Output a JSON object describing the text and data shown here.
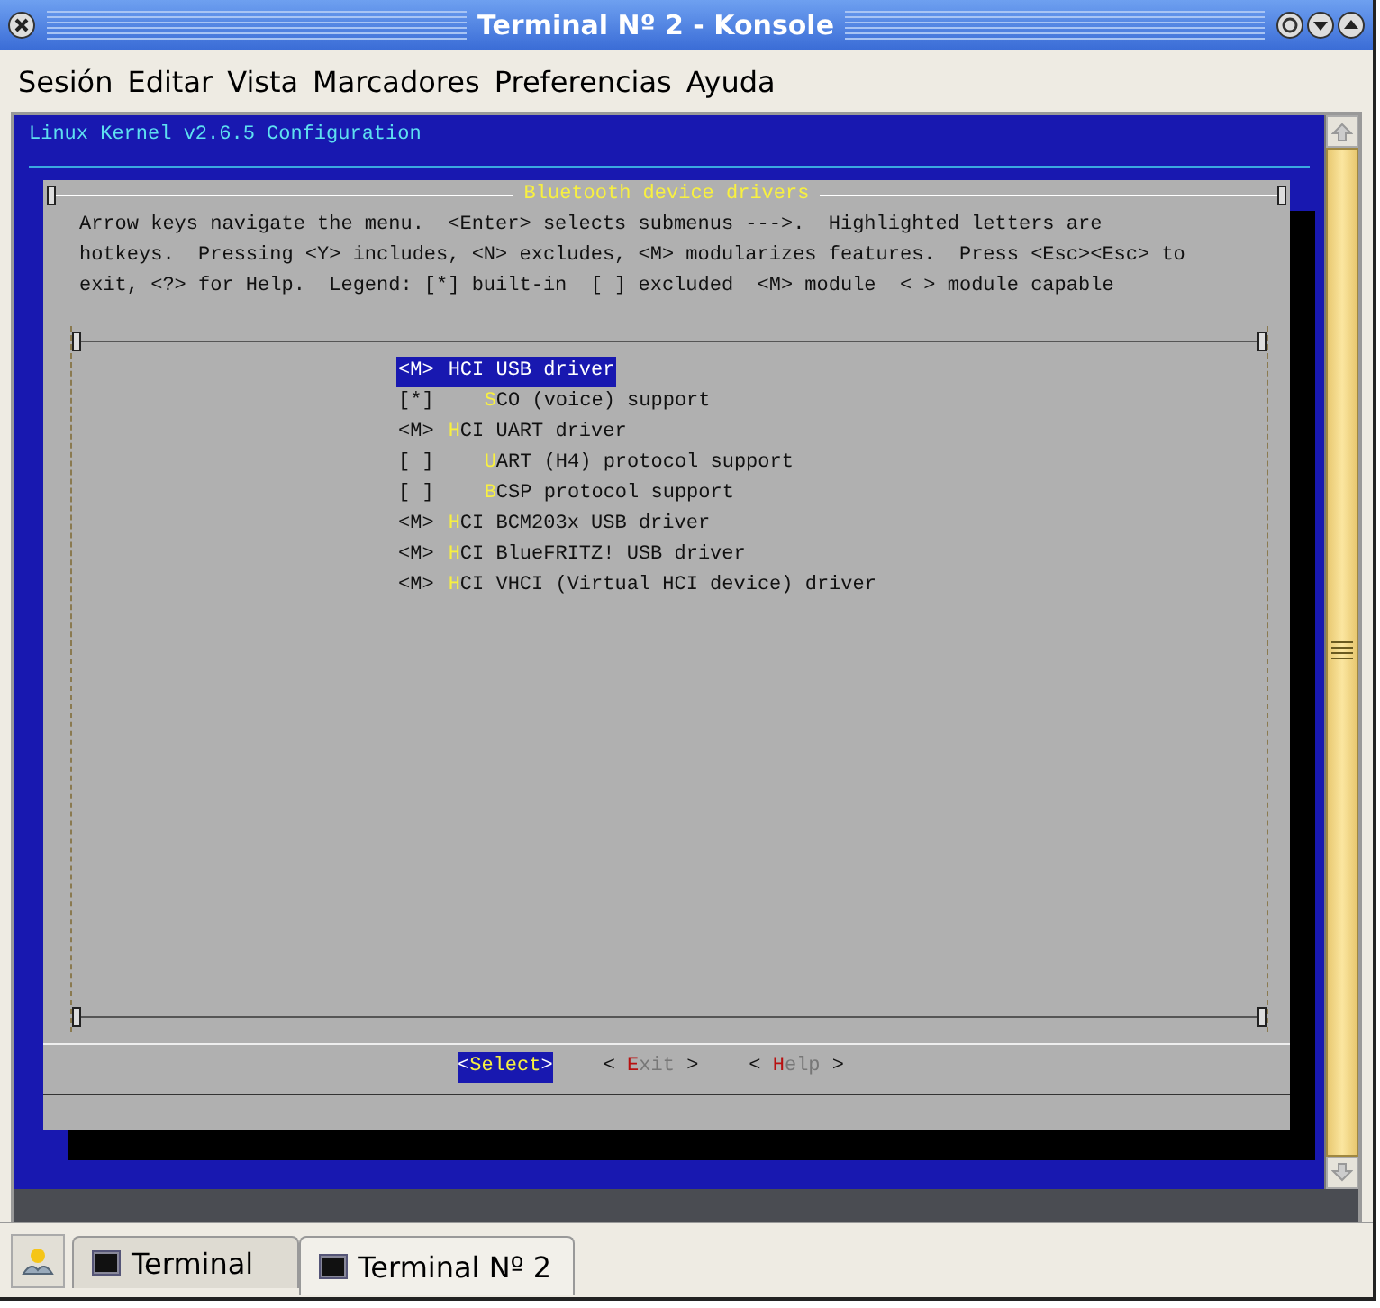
{
  "window": {
    "title": "Terminal Nº 2 - Konsole"
  },
  "menu": [
    "Sesión",
    "Editar",
    "Vista",
    "Marcadores",
    "Preferencias",
    "Ayuda"
  ],
  "terminal": {
    "header": "Linux Kernel v2.6.5 Configuration",
    "dialog": {
      "title": "Bluetooth device drivers",
      "help_lines": [
        "Arrow keys navigate the menu.  <Enter> selects submenus --->.  Highlighted letters are",
        "hotkeys.  Pressing <Y> includes, <N> excludes, <M> modularizes features.  Press <Esc><Esc> to",
        "exit, <?> for Help.  Legend: [*] built-in  [ ] excluded  <M> module  < > module capable"
      ],
      "items": [
        {
          "marker": "<M>",
          "label": "HCI USB driver",
          "selected": true,
          "children": [
            {
              "marker": "[*]",
              "label": "SCO (voice) support",
              "selected": false
            }
          ]
        },
        {
          "marker": "<M>",
          "label": "HCI UART driver",
          "selected": false,
          "children": [
            {
              "marker": "[ ]",
              "label": "UART (H4) protocol support",
              "selected": false
            },
            {
              "marker": "[ ]",
              "label": "BCSP protocol support",
              "selected": false
            }
          ]
        },
        {
          "marker": "<M>",
          "label": "HCI BCM203x USB driver",
          "selected": false
        },
        {
          "marker": "<M>",
          "label": "HCI BlueFRITZ! USB driver",
          "selected": false
        },
        {
          "marker": "<M>",
          "label": "HCI VHCI (Virtual HCI device) driver",
          "selected": false
        }
      ],
      "buttons": [
        {
          "left": "<",
          "label": "Select",
          "right": ">",
          "selected": true
        },
        {
          "left": "< ",
          "label": "Exit",
          "right": " >",
          "selected": false
        },
        {
          "left": "< ",
          "label": "Help",
          "right": " >",
          "selected": false
        }
      ]
    }
  },
  "tabs": [
    {
      "label": "Terminal",
      "selected": false
    },
    {
      "label": "Terminal Nº 2",
      "selected": true
    }
  ]
}
